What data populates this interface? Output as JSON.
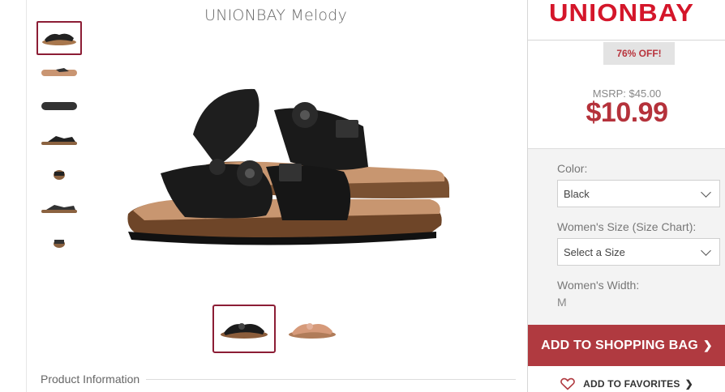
{
  "product": {
    "title": "UNIONBAY Melody"
  },
  "gallery": {
    "thumbnails": [
      {
        "name": "thumb-angle-black"
      },
      {
        "name": "thumb-side-sole"
      },
      {
        "name": "thumb-bottom"
      },
      {
        "name": "thumb-side"
      },
      {
        "name": "thumb-front"
      },
      {
        "name": "thumb-top"
      },
      {
        "name": "thumb-back"
      }
    ],
    "selected_index": 0
  },
  "swatches": {
    "items": [
      "Black",
      "Tan"
    ],
    "selected": "Black"
  },
  "section": {
    "product_information": "Product Information"
  },
  "brand": {
    "logo_text": "UNIONBAY",
    "color": "#d4162a"
  },
  "pricing": {
    "discount_badge": "76% OFF!",
    "msrp": "MSRP: $45.00",
    "price": "$10.99",
    "accent": "#b5323b"
  },
  "options": {
    "color_label": "Color:",
    "color_value": "Black",
    "size_label": "Women's Size (Size Chart):",
    "size_placeholder": "Select a Size",
    "width_label": "Women's Width:",
    "width_value": "M"
  },
  "actions": {
    "add_to_bag": "ADD TO SHOPPING BAG",
    "add_to_favorites": "ADD TO FAVORITES"
  },
  "icons": {
    "bag_arrow": "chevron-right-icon",
    "favorites": "heart-icon"
  }
}
